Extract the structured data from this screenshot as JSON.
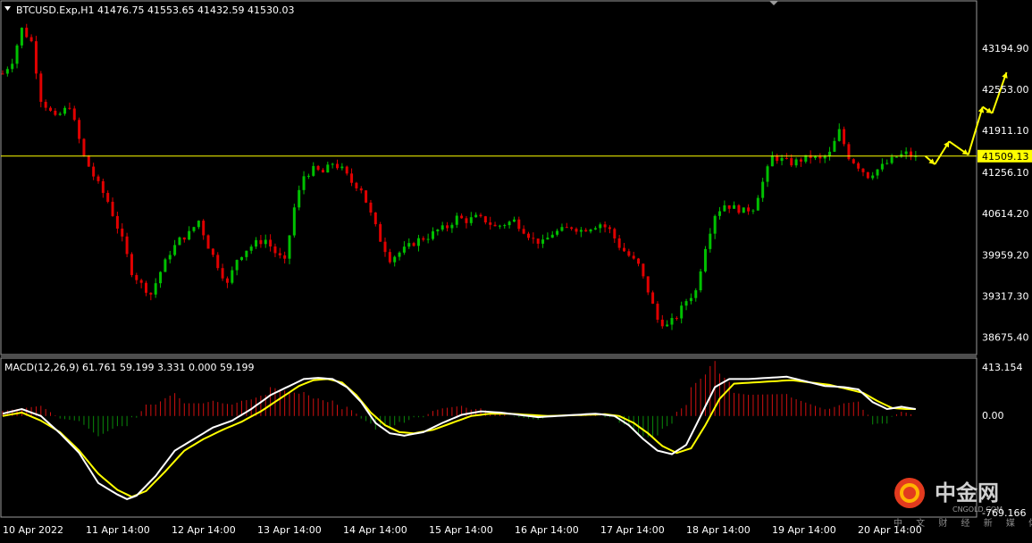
{
  "window": {
    "symbol_header": "BTCUSD.Exp,H1  41476.75 41553.65 41432.59 41530.03",
    "macd_header": "MACD(12,26,9) 61.761 59.199 3.331 0.000 59.199"
  },
  "price_axis": {
    "labels": [
      "43194.90",
      "42553.00",
      "41911.10",
      "41256.10",
      "40614.20",
      "39959.20",
      "39317.30",
      "38675.40"
    ],
    "current_price_label": "41509.13",
    "ylim": [
      38460,
      43700
    ]
  },
  "macd_axis": {
    "labels": [
      "413.154",
      "0.00",
      "-769.166"
    ],
    "ylim": [
      -860,
      470
    ]
  },
  "time_axis": {
    "labels": [
      "10 Apr 2022",
      "11 Apr 14:00",
      "12 Apr 14:00",
      "13 Apr 14:00",
      "14 Apr 14:00",
      "15 Apr 14:00",
      "16 Apr 14:00",
      "17 Apr 14:00",
      "18 Apr 14:00",
      "19 Apr 14:00",
      "20 Apr 14:00"
    ]
  },
  "watermark": {
    "chinese": "中金网",
    "english": "CNGOLD.COM",
    "subtitle": "中 文 财 经 新 媒 体"
  },
  "colors": {
    "background": "#000000",
    "bull_candle": "#00c000",
    "bear_candle": "#e00000",
    "horizontal_line": "#ffff00",
    "price_tag_bg": "#ffff00",
    "macd_line": "#ffffff",
    "signal_line": "#ffff00",
    "hist_positive": "#d01010",
    "hist_negative": "#0a8a0a",
    "annotation_arrows": "#ffff00"
  },
  "chart_data": {
    "type": "candlestick",
    "price_keypoints": [
      [
        0,
        42800
      ],
      [
        2,
        43000
      ],
      [
        4,
        43500
      ],
      [
        6,
        43300
      ],
      [
        8,
        42400
      ],
      [
        11,
        42100
      ],
      [
        14,
        42300
      ],
      [
        17,
        41500
      ],
      [
        19,
        41200
      ],
      [
        22,
        40800
      ],
      [
        25,
        40200
      ],
      [
        27,
        39700
      ],
      [
        29,
        39500
      ],
      [
        31,
        39350
      ],
      [
        33,
        39700
      ],
      [
        35,
        40000
      ],
      [
        37,
        40200
      ],
      [
        39,
        40300
      ],
      [
        41,
        40500
      ],
      [
        43,
        40100
      ],
      [
        45,
        39800
      ],
      [
        47,
        39500
      ],
      [
        49,
        39900
      ],
      [
        51,
        40050
      ],
      [
        53,
        40150
      ],
      [
        55,
        40200
      ],
      [
        57,
        40000
      ],
      [
        59,
        39850
      ],
      [
        61,
        40700
      ],
      [
        63,
        41200
      ],
      [
        65,
        41300
      ],
      [
        67,
        41250
      ],
      [
        69,
        41400
      ],
      [
        71,
        41300
      ],
      [
        73,
        41100
      ],
      [
        75,
        41000
      ],
      [
        77,
        40600
      ],
      [
        79,
        40200
      ],
      [
        81,
        39900
      ],
      [
        83,
        40000
      ],
      [
        85,
        40100
      ],
      [
        87,
        40200
      ],
      [
        89,
        40250
      ],
      [
        91,
        40350
      ],
      [
        93,
        40400
      ],
      [
        95,
        40550
      ],
      [
        97,
        40500
      ],
      [
        99,
        40550
      ],
      [
        101,
        40500
      ],
      [
        103,
        40400
      ],
      [
        105,
        40450
      ],
      [
        107,
        40500
      ],
      [
        109,
        40350
      ],
      [
        111,
        40200
      ],
      [
        113,
        40150
      ],
      [
        115,
        40300
      ],
      [
        117,
        40350
      ],
      [
        119,
        40400
      ],
      [
        121,
        40350
      ],
      [
        123,
        40400
      ],
      [
        125,
        40450
      ],
      [
        127,
        40350
      ],
      [
        129,
        40100
      ],
      [
        131,
        39950
      ],
      [
        133,
        39800
      ],
      [
        135,
        39400
      ],
      [
        137,
        38950
      ],
      [
        139,
        38850
      ],
      [
        141,
        39000
      ],
      [
        143,
        39250
      ],
      [
        145,
        39400
      ],
      [
        147,
        40100
      ],
      [
        149,
        40600
      ],
      [
        151,
        40750
      ],
      [
        153,
        40700
      ],
      [
        155,
        40650
      ],
      [
        157,
        40700
      ],
      [
        159,
        41100
      ],
      [
        161,
        41500
      ],
      [
        163,
        41450
      ],
      [
        165,
        41400
      ],
      [
        167,
        41450
      ],
      [
        169,
        41500
      ],
      [
        171,
        41450
      ],
      [
        173,
        41550
      ],
      [
        175,
        41900
      ],
      [
        177,
        41500
      ],
      [
        179,
        41350
      ],
      [
        181,
        41200
      ],
      [
        183,
        41300
      ],
      [
        185,
        41400
      ],
      [
        187,
        41500
      ],
      [
        189,
        41550
      ],
      [
        191,
        41480
      ]
    ],
    "macd_keypoints": [
      [
        0,
        20
      ],
      [
        4,
        60
      ],
      [
        8,
        0
      ],
      [
        12,
        -150
      ],
      [
        16,
        -320
      ],
      [
        20,
        -580
      ],
      [
        24,
        -680
      ],
      [
        26,
        -720
      ],
      [
        28,
        -690
      ],
      [
        32,
        -520
      ],
      [
        36,
        -300
      ],
      [
        40,
        -200
      ],
      [
        44,
        -100
      ],
      [
        48,
        -40
      ],
      [
        52,
        60
      ],
      [
        56,
        180
      ],
      [
        60,
        260
      ],
      [
        63,
        320
      ],
      [
        66,
        330
      ],
      [
        69,
        320
      ],
      [
        72,
        250
      ],
      [
        75,
        120
      ],
      [
        78,
        -60
      ],
      [
        81,
        -150
      ],
      [
        84,
        -170
      ],
      [
        88,
        -140
      ],
      [
        92,
        -60
      ],
      [
        96,
        10
      ],
      [
        100,
        40
      ],
      [
        104,
        30
      ],
      [
        108,
        10
      ],
      [
        112,
        -10
      ],
      [
        116,
        0
      ],
      [
        120,
        10
      ],
      [
        124,
        20
      ],
      [
        128,
        0
      ],
      [
        131,
        -80
      ],
      [
        134,
        -200
      ],
      [
        137,
        -300
      ],
      [
        140,
        -330
      ],
      [
        143,
        -250
      ],
      [
        146,
        0
      ],
      [
        149,
        250
      ],
      [
        152,
        320
      ],
      [
        156,
        320
      ],
      [
        160,
        330
      ],
      [
        164,
        340
      ],
      [
        168,
        300
      ],
      [
        172,
        260
      ],
      [
        176,
        250
      ],
      [
        179,
        230
      ],
      [
        182,
        120
      ],
      [
        185,
        60
      ],
      [
        188,
        80
      ],
      [
        191,
        60
      ]
    ],
    "signal_keypoints": [
      [
        0,
        0
      ],
      [
        4,
        30
      ],
      [
        8,
        -40
      ],
      [
        12,
        -140
      ],
      [
        16,
        -300
      ],
      [
        20,
        -500
      ],
      [
        24,
        -640
      ],
      [
        27,
        -700
      ],
      [
        30,
        -650
      ],
      [
        34,
        -480
      ],
      [
        38,
        -300
      ],
      [
        42,
        -200
      ],
      [
        46,
        -120
      ],
      [
        50,
        -50
      ],
      [
        54,
        40
      ],
      [
        58,
        150
      ],
      [
        62,
        260
      ],
      [
        65,
        310
      ],
      [
        68,
        320
      ],
      [
        71,
        290
      ],
      [
        74,
        180
      ],
      [
        77,
        30
      ],
      [
        80,
        -80
      ],
      [
        83,
        -140
      ],
      [
        86,
        -150
      ],
      [
        90,
        -120
      ],
      [
        94,
        -60
      ],
      [
        98,
        0
      ],
      [
        102,
        20
      ],
      [
        106,
        20
      ],
      [
        110,
        10
      ],
      [
        114,
        0
      ],
      [
        118,
        5
      ],
      [
        122,
        10
      ],
      [
        126,
        15
      ],
      [
        129,
        0
      ],
      [
        132,
        -60
      ],
      [
        135,
        -150
      ],
      [
        138,
        -260
      ],
      [
        141,
        -320
      ],
      [
        144,
        -280
      ],
      [
        147,
        -80
      ],
      [
        150,
        150
      ],
      [
        153,
        280
      ],
      [
        157,
        290
      ],
      [
        161,
        300
      ],
      [
        165,
        310
      ],
      [
        169,
        290
      ],
      [
        173,
        270
      ],
      [
        177,
        230
      ],
      [
        180,
        200
      ],
      [
        183,
        130
      ],
      [
        186,
        70
      ],
      [
        189,
        60
      ],
      [
        191,
        60
      ]
    ],
    "current_price": 41509.13,
    "annotation_path": [
      [
        193,
        41509
      ],
      [
        195,
        41380
      ],
      [
        198,
        41740
      ],
      [
        202,
        41530
      ],
      [
        205,
        42280
      ],
      [
        207,
        42180
      ],
      [
        210,
        42820
      ]
    ]
  }
}
